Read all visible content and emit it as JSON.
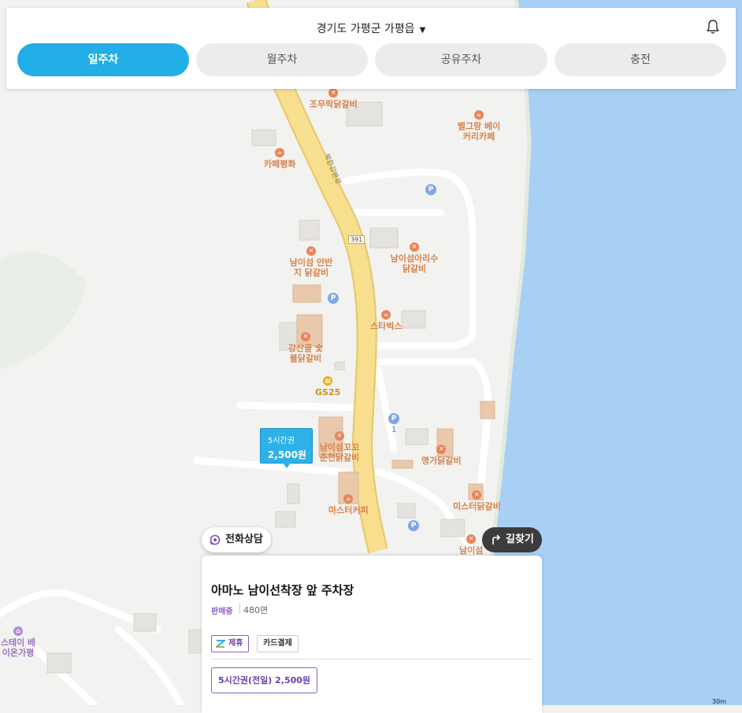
{
  "header": {
    "region": "경기도 가평군 가평읍",
    "tabs": [
      {
        "label": "일주차",
        "active": true
      },
      {
        "label": "월주차",
        "active": false
      },
      {
        "label": "공유주차",
        "active": false
      },
      {
        "label": "충전",
        "active": false
      }
    ]
  },
  "map": {
    "road_name": "북한강변로",
    "route_number": "391",
    "pois": [
      {
        "name": "조무락닭갈비",
        "icon": "restaurant"
      },
      {
        "name": "벨그랑 베이커리카페",
        "icon": "cafe"
      },
      {
        "name": "카페평화",
        "icon": "cafe"
      },
      {
        "name": "남이섬 안반지 닭갈비",
        "icon": "restaurant"
      },
      {
        "name": "남이섬아리수 닭갈비",
        "icon": "restaurant"
      },
      {
        "name": "스타벅스",
        "icon": "cafe"
      },
      {
        "name": "강산골 숯불닭갈비",
        "icon": "restaurant"
      },
      {
        "name": "GS25",
        "icon": "convenience-store"
      },
      {
        "name": "남이섬꼬꼬 춘천닭갈비",
        "icon": "restaurant"
      },
      {
        "name": "명가닭갈비",
        "icon": "restaurant"
      },
      {
        "name": "미스터닭갈비",
        "icon": "restaurant"
      },
      {
        "name": "마스터커피",
        "icon": "cafe"
      },
      {
        "name": "남이섬",
        "icon": "restaurant"
      },
      {
        "name": "스테이 베이온가평",
        "icon": "lodging"
      }
    ],
    "parking_pin_count_label": "1",
    "scale_label": "30m"
  },
  "marker": {
    "ticket": "5시간권",
    "price": "2,500원"
  },
  "buttons": {
    "call": "전화상담",
    "directions": "길찾기"
  },
  "card": {
    "title": "아마노 남이선착장 앞 주차장",
    "status": "판매중",
    "spaces": "480면",
    "tags": {
      "partner": "제휴",
      "card_payment": "카드결제"
    },
    "ticket_option": "5시간권(전일) 2,500원"
  },
  "colors": {
    "accent": "#22aee6",
    "purple": "#8b5cc4",
    "water": "#a8d0f4",
    "road_main": "#f7df8f"
  }
}
